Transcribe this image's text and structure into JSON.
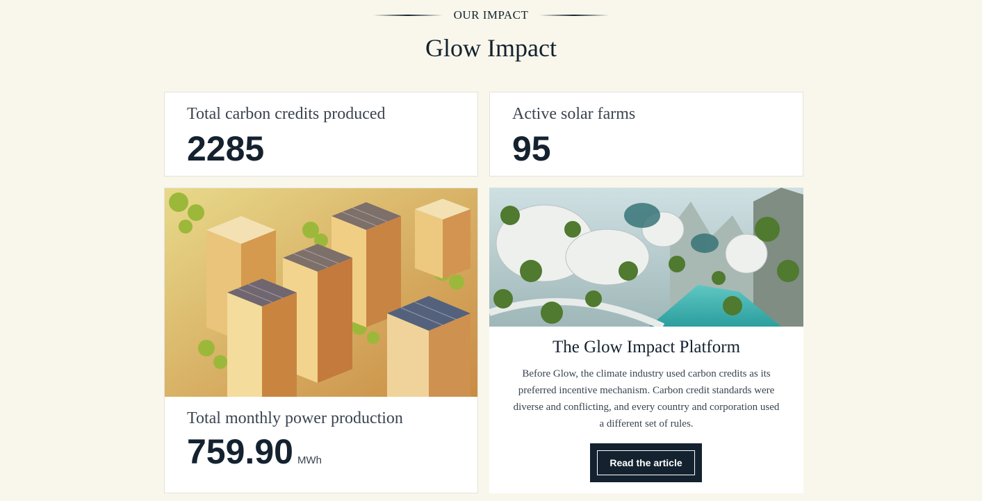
{
  "header": {
    "eyebrow": "OUR IMPACT",
    "title": "Glow Impact"
  },
  "stats": {
    "carbon": {
      "label": "Total carbon credits produced",
      "value": "2285"
    },
    "farms": {
      "label": "Active solar farms",
      "value": "95"
    },
    "power": {
      "label": "Total monthly power production",
      "value": "759.90",
      "unit": "MWh"
    }
  },
  "platform": {
    "title": "The Glow Impact Platform",
    "description": "Before Glow, the climate industry used carbon credits as its preferred incentive mechanism. Carbon credit standards were diverse and conflicting, and every country and corporation used a different set of rules.",
    "button_label": "Read the article"
  },
  "colors": {
    "background": "#f9f7eb",
    "card": "#ffffff",
    "ink": "#142230",
    "muted": "#3a4450"
  }
}
